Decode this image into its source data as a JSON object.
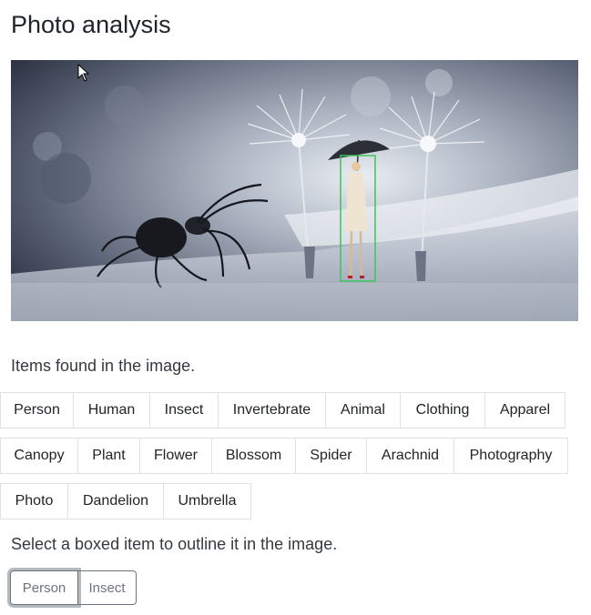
{
  "page": {
    "title": "Photo analysis"
  },
  "photo": {
    "alt": "",
    "selected_item": "Person"
  },
  "results": {
    "caption": "Items found in the image.",
    "rows": [
      [
        "Person",
        "Human",
        "Insect",
        "Invertebrate",
        "Animal",
        "Clothing",
        "Apparel"
      ],
      [
        "Canopy",
        "Plant",
        "Flower",
        "Blossom",
        "Spider",
        "Arachnid",
        "Photography"
      ],
      [
        "Photo",
        "Dandelion",
        "Umbrella"
      ]
    ]
  },
  "selection": {
    "instruction": "Select a boxed item to outline it in the image.",
    "buttons": [
      "Person",
      "Insect"
    ]
  },
  "colors": {
    "box_outline": "#3cc45a",
    "button_border": "#6c757d"
  }
}
